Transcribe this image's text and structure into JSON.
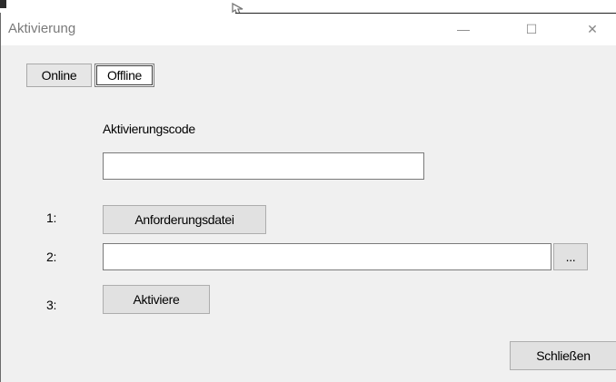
{
  "window": {
    "title": "Aktivierung",
    "controls": {
      "minimize_glyph": "—",
      "maximize_glyph": "☐",
      "close_glyph": "✕"
    }
  },
  "tabs": [
    {
      "label": "Online",
      "selected": false
    },
    {
      "label": "Offline",
      "selected": true
    }
  ],
  "offline": {
    "code_label": "Aktivierungscode",
    "code_value": "",
    "steps": [
      {
        "number": "1:",
        "button_label": "Anforderungsdatei"
      },
      {
        "number": "2:",
        "file_value": "",
        "browse_label": "..."
      },
      {
        "number": "3:",
        "button_label": "Aktiviere"
      }
    ]
  },
  "footer": {
    "close_label": "Schließen"
  },
  "icons": {
    "pointer": "hand-pointer-icon",
    "minimize": "minimize-icon",
    "maximize": "maximize-icon",
    "close": "close-icon"
  }
}
